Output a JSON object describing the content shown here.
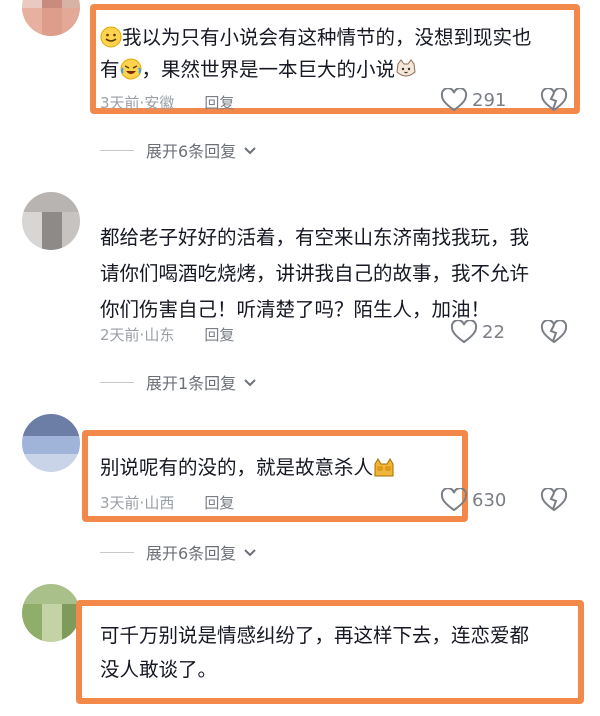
{
  "comments": [
    {
      "username": "",
      "text_line1": "我以为只有小说会有这种情节的，没想到现实也",
      "text_line2_a": "有",
      "text_line2_b": "，果然世界是一本巨大的小说",
      "time": "3天前",
      "location": "安徽",
      "reply_label": "回复",
      "likes": "291",
      "expand_label": "展开6条回复"
    },
    {
      "username": "",
      "text_line1": "都给老子好好的活着，有空来山东济南找我玩，我",
      "text_line2": "请你们喝酒吃烧烤，讲讲我自己的故事，我不允许",
      "text_line3": "你们伤害自己！听清楚了吗？陌生人，加油！",
      "time": "2天前",
      "location": "山东",
      "reply_label": "回复",
      "likes": "22",
      "expand_label": "展开1条回复"
    },
    {
      "username": "",
      "text_line1": "别说呢有的没的，就是故意杀人",
      "time": "3天前",
      "location": "山西",
      "reply_label": "回复",
      "likes": "630",
      "expand_label": "展开6条回复"
    },
    {
      "username": "",
      "text_line1": "可千万别说是情感纠纷了，再这样下去，连恋爱都",
      "text_line2": "没人敢谈了。",
      "time": "",
      "location": ""
    }
  ],
  "separator": " · ",
  "colors": {
    "highlight": "#f2894a",
    "meta": "#9aa0a6",
    "text": "#161823"
  },
  "icons": [
    "heart-outline-icon",
    "broken-heart-icon",
    "chevron-down-icon",
    "smile-emoji-icon",
    "laugh-cry-emoji-icon",
    "cat-emoji-icon",
    "cat-cover-eyes-emoji-icon"
  ]
}
